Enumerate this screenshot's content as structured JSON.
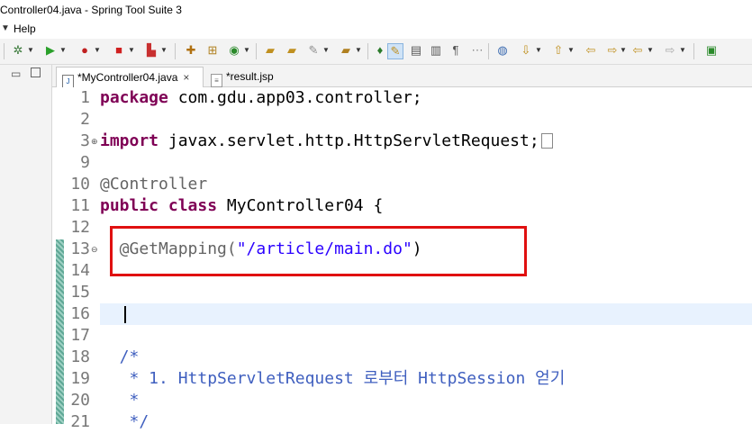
{
  "window": {
    "title": "Controller04.java - Spring Tool Suite 3"
  },
  "menubar": {
    "help_label": "Help"
  },
  "toolbar": {
    "icons": [
      "debug-icon",
      "run-icon",
      "run-external-icon",
      "stop-icon",
      "deploy-icon",
      "new-java-project-icon",
      "new-package-icon",
      "new-class-icon",
      "open-type-icon",
      "open-task-icon",
      "wand-icon",
      "search-icon",
      "pin-icon",
      "highlight-icon",
      "markers-icon",
      "split-icon",
      "paragraph-icon",
      "whitespace-icon",
      "globe-icon",
      "next-annotation-icon",
      "prev-annotation-icon",
      "back-icon",
      "forward-icon",
      "navigate-back-icon",
      "navigate-forward-icon",
      "new-window-icon"
    ]
  },
  "tabs": [
    {
      "label": "*MyController04.java",
      "close": "×",
      "icon": "J"
    },
    {
      "label": "*result.jsp",
      "icon": "📄"
    }
  ],
  "editor": {
    "lines": [
      {
        "n": "1",
        "parts": [
          {
            "t": "package",
            "c": "kw"
          },
          {
            "t": " com.gdu.app03.controller;",
            "c": ""
          }
        ]
      },
      {
        "n": "2",
        "parts": []
      },
      {
        "n": "3",
        "fold": "⊕",
        "parts": [
          {
            "t": "import",
            "c": "kw"
          },
          {
            "t": " javax.servlet.http.HttpServletRequest;",
            "c": ""
          }
        ],
        "ellipsis": true
      },
      {
        "n": "9",
        "parts": []
      },
      {
        "n": "10",
        "parts": [
          {
            "t": "@Controller",
            "c": "ann"
          }
        ]
      },
      {
        "n": "11",
        "parts": [
          {
            "t": "public",
            "c": "kw"
          },
          {
            "t": " ",
            "c": ""
          },
          {
            "t": "class",
            "c": "kw"
          },
          {
            "t": " MyController04 {",
            "c": ""
          }
        ]
      },
      {
        "n": "12",
        "parts": []
      },
      {
        "n": "13",
        "fold": "⊖",
        "parts": [
          {
            "t": "  @GetMapping(",
            "c": "ann"
          },
          {
            "t": "\"/article/main.do\"",
            "c": "str"
          },
          {
            "t": ")",
            "c": ""
          }
        ]
      },
      {
        "n": "14",
        "parts": []
      },
      {
        "n": "15",
        "parts": []
      },
      {
        "n": "16",
        "parts": []
      },
      {
        "n": "17",
        "parts": []
      },
      {
        "n": "18",
        "parts": [
          {
            "t": "  /*",
            "c": "cmt"
          }
        ]
      },
      {
        "n": "19",
        "parts": [
          {
            "t": "   * 1. HttpServletRequest 로부터 HttpSession 얻기",
            "c": "cmt"
          }
        ]
      },
      {
        "n": "20",
        "parts": [
          {
            "t": "   *",
            "c": "cmt"
          }
        ]
      },
      {
        "n": "21",
        "parts": [
          {
            "t": "   */",
            "c": "cmt"
          }
        ]
      }
    ]
  },
  "colors": {
    "keyword": "#7f0055",
    "annotation": "#646464",
    "string": "#2a00ff",
    "comment": "#3f5fbf",
    "highlight_box": "#e01010"
  }
}
